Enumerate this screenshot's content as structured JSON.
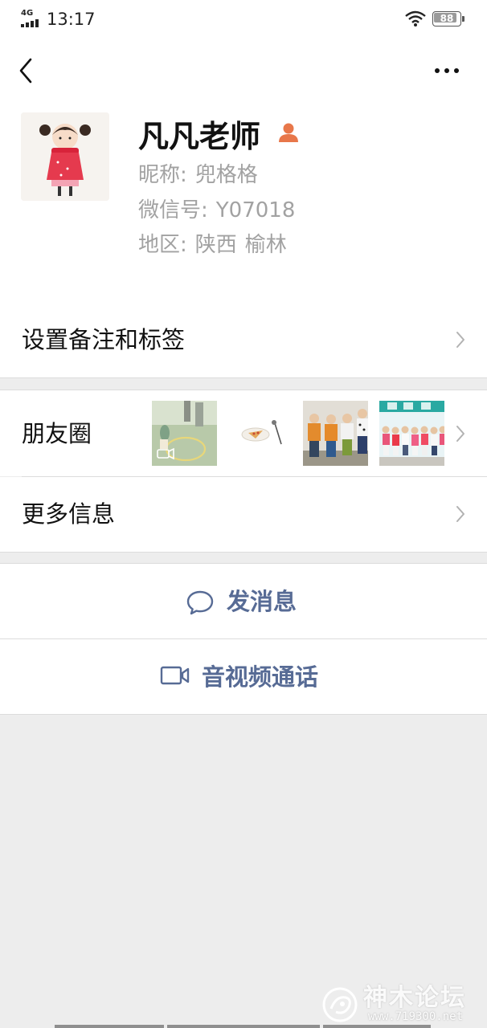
{
  "status_bar": {
    "network": "4G",
    "time": "13:17",
    "battery_level": "88",
    "battery_fraction": 0.88
  },
  "nav": {
    "back_icon": "chevron-left-icon",
    "more_icon": "ellipsis-icon"
  },
  "profile": {
    "display_name": "凡凡老师",
    "gender_icon": "person-icon",
    "gender_icon_color": "#e8774a",
    "nickname_label": "昵称:",
    "nickname": "兜格格",
    "wechat_id_label": "微信号:",
    "wechat_id": "Y07018",
    "region_label": "地区:",
    "region_province": "陕西",
    "region_city": "榆林"
  },
  "rows": {
    "remark_tags": "设置备注和标签",
    "moments": "朋友圈",
    "more_info": "更多信息"
  },
  "moments_thumbnails": [
    {
      "name": "moment-thumb-video",
      "has_video_icon": true
    },
    {
      "name": "moment-thumb-food"
    },
    {
      "name": "moment-thumb-kids"
    },
    {
      "name": "moment-thumb-group"
    }
  ],
  "actions": {
    "send_message": "发消息",
    "send_message_icon": "chat-bubble-icon",
    "av_call": "音视频通话",
    "av_call_icon": "video-camera-icon"
  },
  "colors": {
    "link_blue": "#576b95",
    "secondary_gray": "#a2a2a2",
    "background": "#ededed"
  },
  "watermark": {
    "text": "神木论坛",
    "url": "www.719300.net"
  }
}
